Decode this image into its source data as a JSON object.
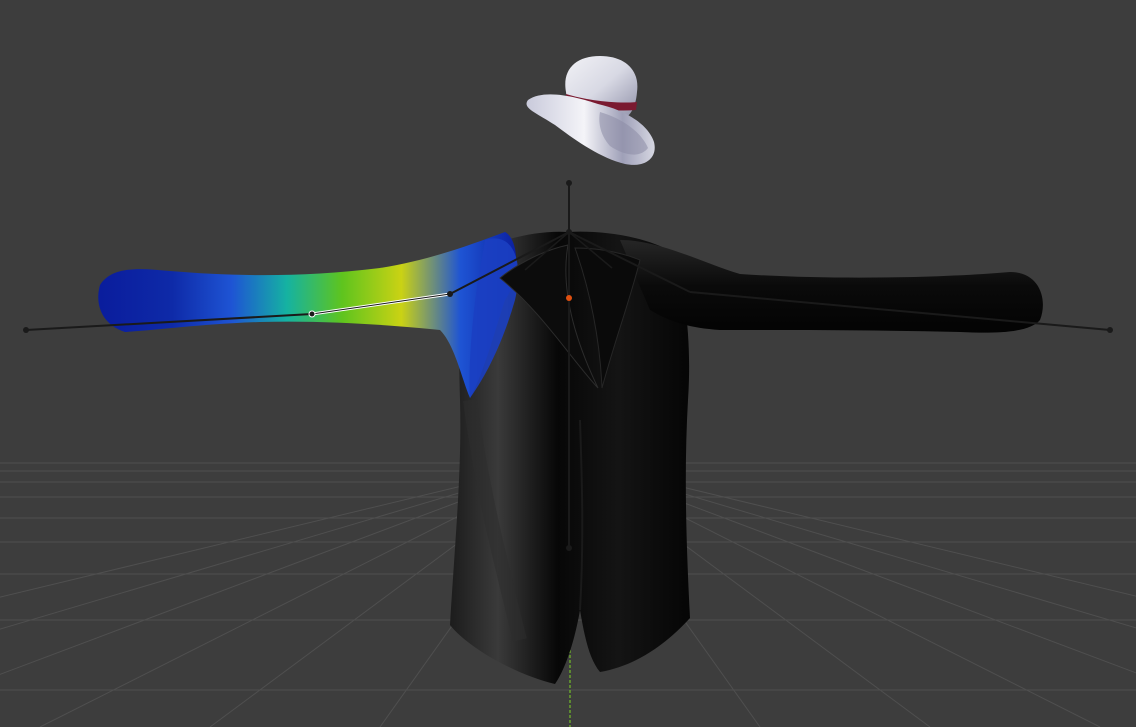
{
  "viewport": {
    "mode": "weight-paint",
    "background_color": "#3d3d3d",
    "grid_color": "#4f4f4f",
    "y_axis_color": "#6fb32a",
    "object_origin_color": "#e05010"
  },
  "scene": {
    "objects": [
      {
        "name": "hat",
        "material_colors": [
          "#e6e7ef",
          "#7a1a30"
        ]
      },
      {
        "name": "jacket",
        "shading_color": "#080808"
      },
      {
        "name": "armature",
        "bone_color": "#1a1a1a",
        "selected_bone": "left-upper-arm"
      }
    ],
    "weight_gradient": [
      "#0a1c9c",
      "#1e54d4",
      "#15b2a2",
      "#5ec41e",
      "#cad214",
      "#1e54d4",
      "#0a1c9c"
    ]
  }
}
